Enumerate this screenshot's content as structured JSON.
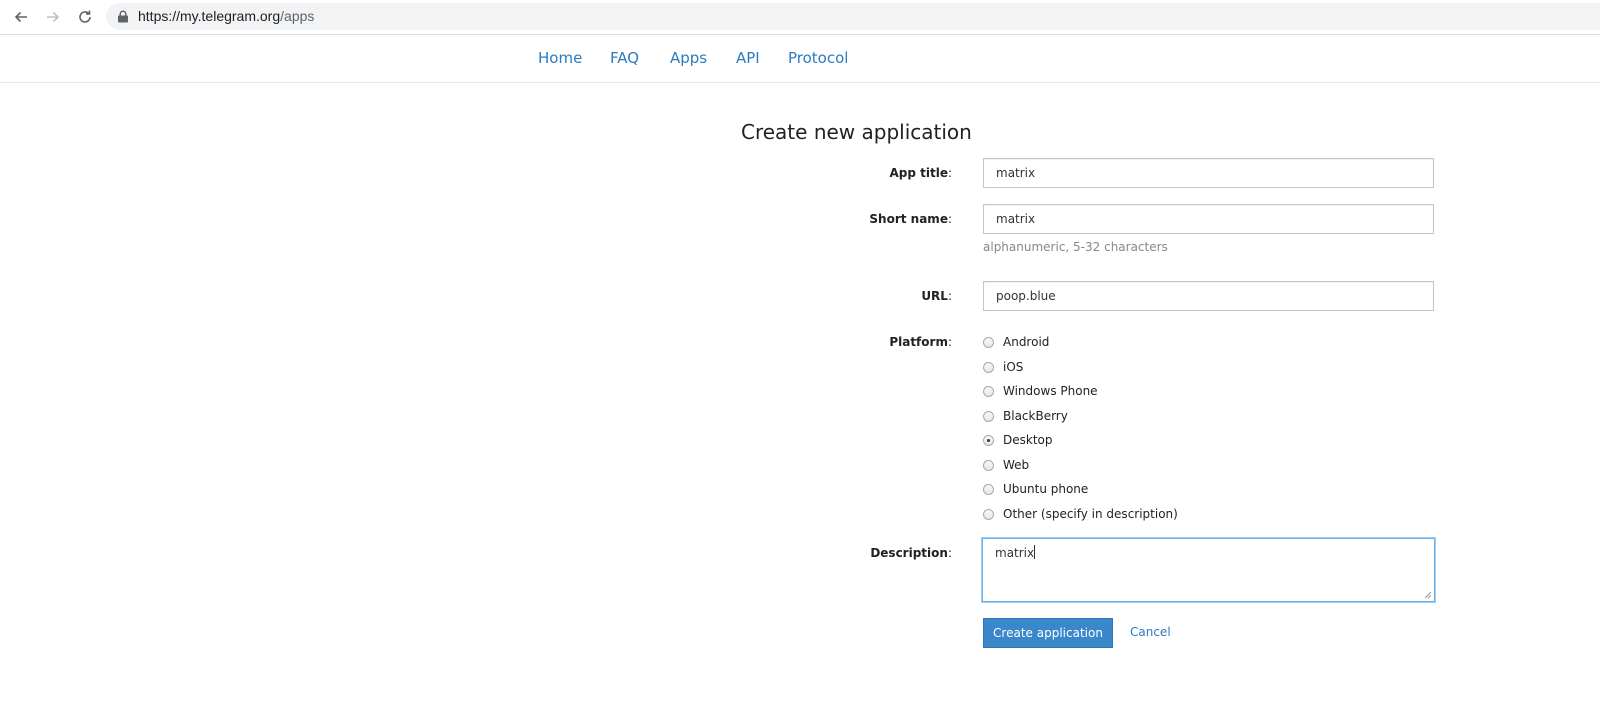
{
  "browser": {
    "url_host": "https://my.telegram.org",
    "url_path": "/apps"
  },
  "nav": {
    "items": [
      {
        "label": "Home"
      },
      {
        "label": "FAQ"
      },
      {
        "label": "Apps"
      },
      {
        "label": "API"
      },
      {
        "label": "Protocol"
      }
    ]
  },
  "form": {
    "title": "Create new application",
    "app_title": {
      "label": "App title",
      "value": "matrix"
    },
    "short_name": {
      "label": "Short name",
      "value": "matrix",
      "hint": "alphanumeric, 5-32 characters"
    },
    "url": {
      "label": "URL",
      "value": "poop.blue"
    },
    "platform": {
      "label": "Platform",
      "selected": "Desktop",
      "options": [
        {
          "label": "Android"
        },
        {
          "label": "iOS"
        },
        {
          "label": "Windows Phone"
        },
        {
          "label": "BlackBerry"
        },
        {
          "label": "Desktop"
        },
        {
          "label": "Web"
        },
        {
          "label": "Ubuntu phone"
        },
        {
          "label": "Other (specify in description)"
        }
      ]
    },
    "description": {
      "label": "Description",
      "value": "matrix"
    },
    "submit_label": "Create application",
    "cancel_label": "Cancel"
  },
  "colors": {
    "link": "#2a7bbf",
    "primary_button": "#3a87cc",
    "focus_border": "#66afe9"
  }
}
